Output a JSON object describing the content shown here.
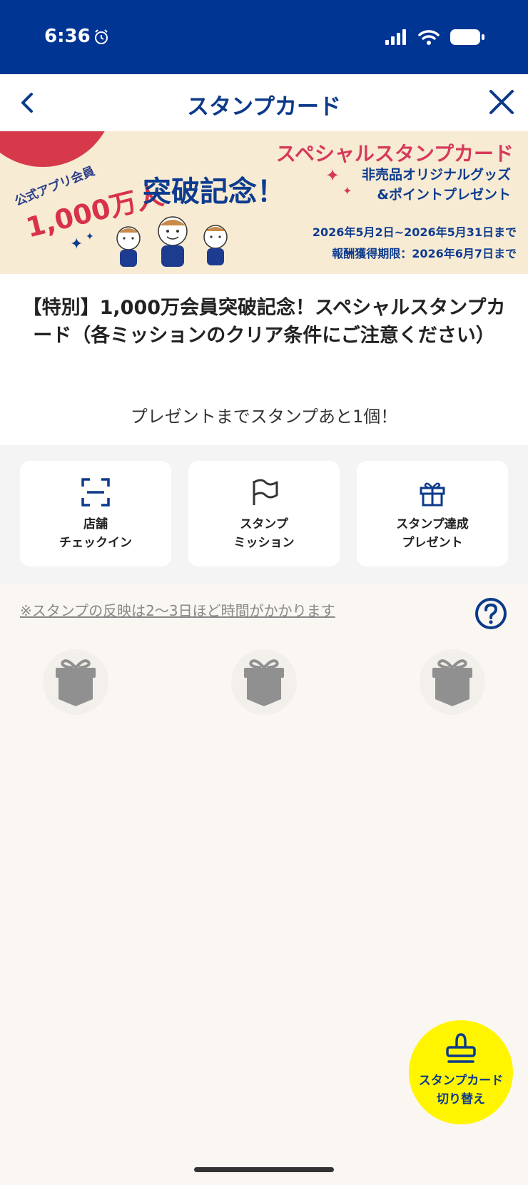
{
  "status_bar": {
    "time": "6:36"
  },
  "nav": {
    "title": "スタンプカード"
  },
  "banner": {
    "sub_left": "公式アプリ会員",
    "big_number": "1,000万人",
    "kinen": "突破記念！",
    "special": "スペシャルスタンプカード",
    "goods_line1": "非売品オリジナルグッズ",
    "goods_line2": "&ポイントプレゼント",
    "period": "2026年5月2日~2026年5月31日まで",
    "reward_deadline": "報酬獲得期限：2026年6月7日まで"
  },
  "card": {
    "title": "【特別】1,000万会員突破記念！スペシャルスタンプカード（各ミッションのクリア条件にご注意ください）",
    "remaining": "プレゼントまでスタンプあと1個！"
  },
  "actions": [
    {
      "label": "店舗\nチェックイン",
      "icon": "qr-scan-icon"
    },
    {
      "label": "スタンプ\nミッション",
      "icon": "flag-icon"
    },
    {
      "label": "スタンプ達成\nプレゼント",
      "icon": "gift-icon"
    }
  ],
  "stamp_area": {
    "notice": "※スタンプの反映は2〜3日ほど時間がかかります",
    "slots": 3
  },
  "fab": {
    "label": "スタンプカード\n切り替え",
    "icon": "stamp-icon"
  },
  "colors": {
    "brand_blue": "#003594",
    "accent_yellow": "#fff500",
    "accent_red": "#d63a4a"
  }
}
